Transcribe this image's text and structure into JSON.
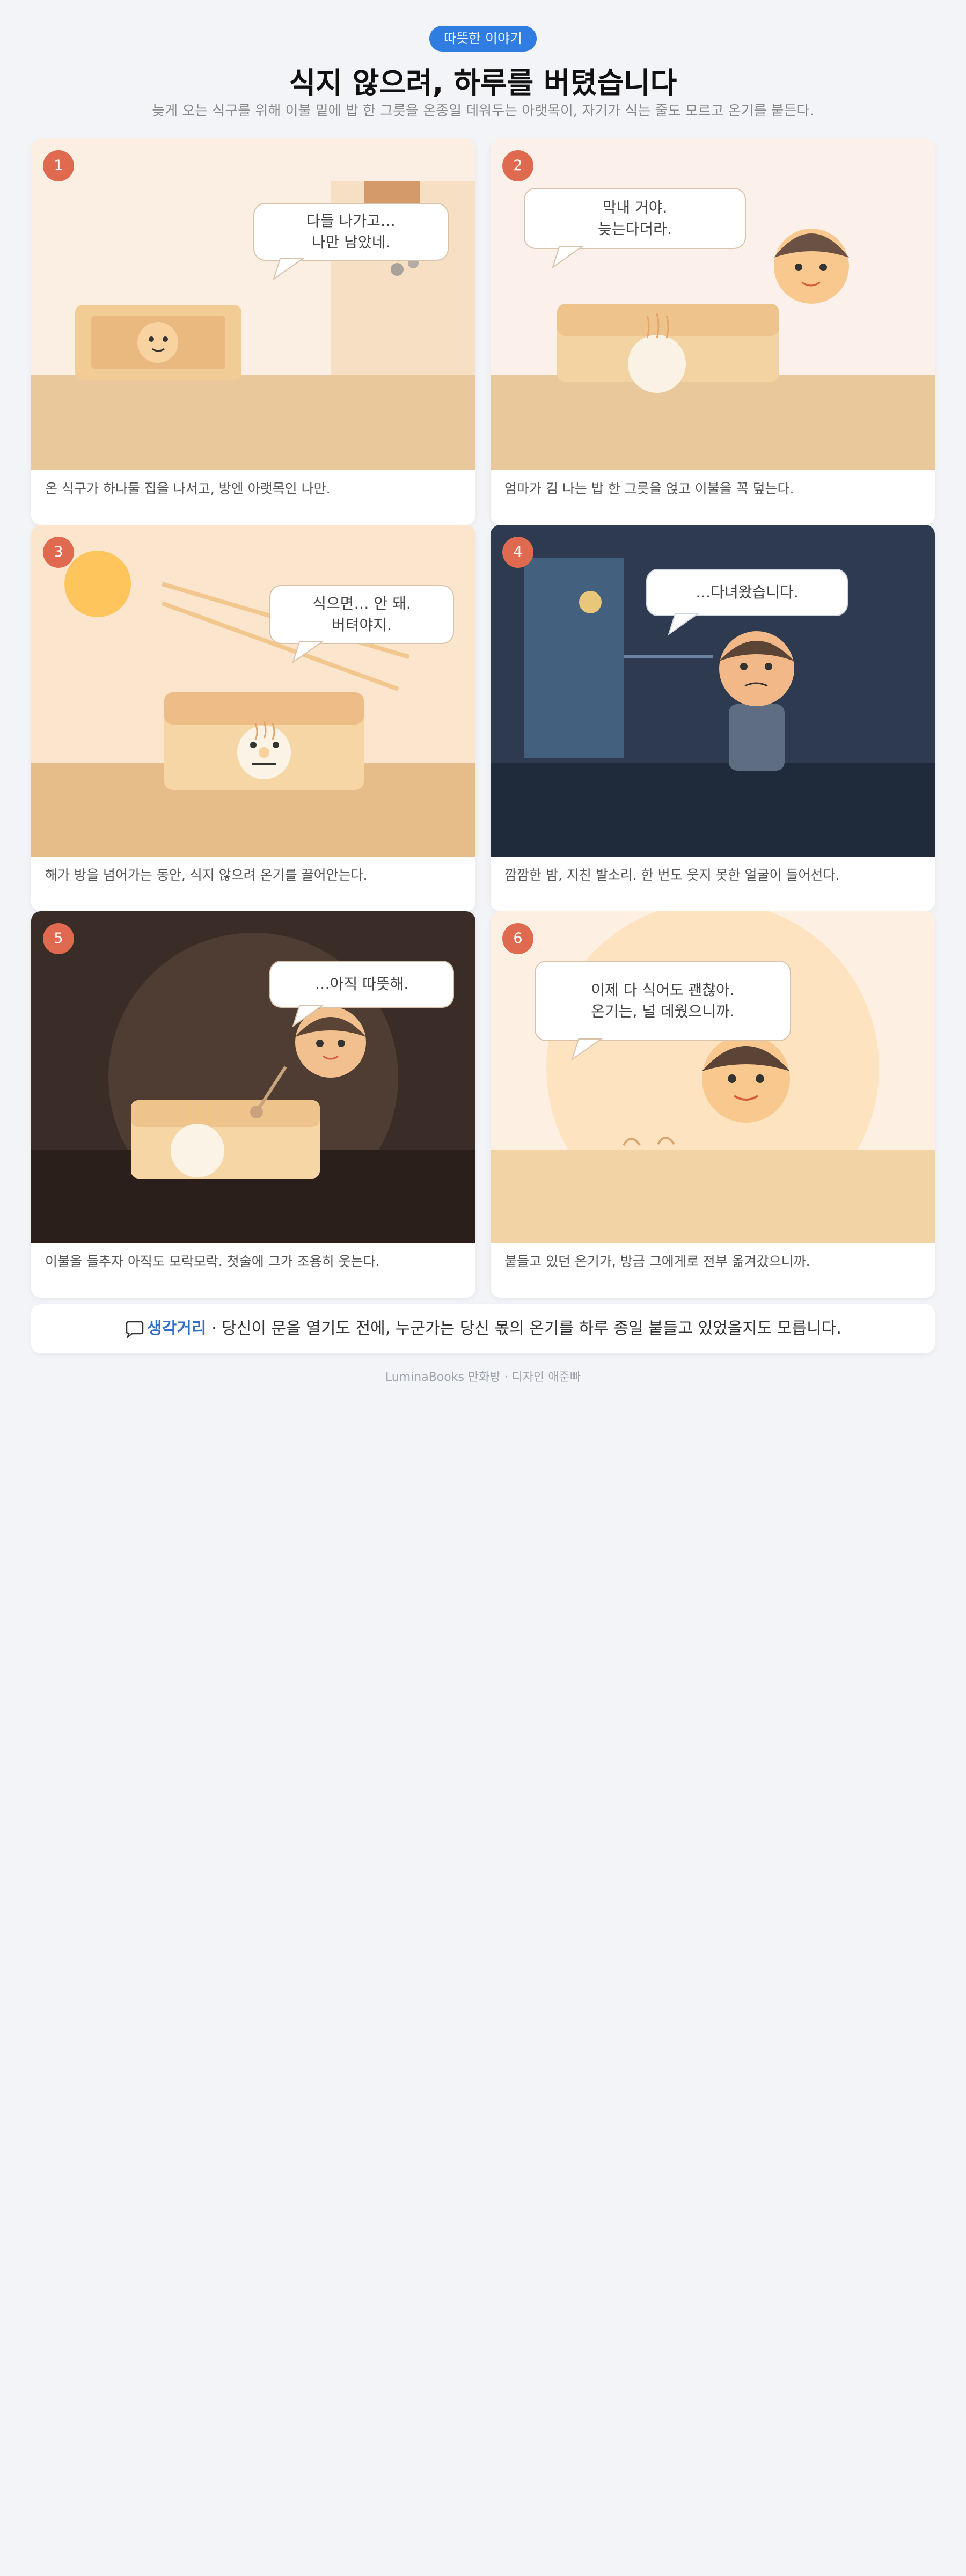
{
  "badge": "따뜻한 이야기",
  "title": "식지 않으려, 하루를 버텼습니다",
  "subtitle": "늦게 오는 식구를 위해 이불 밑에 밥 한 그릇을 온종일 데워두는 아랫목이, 자기가 식는 줄도 모르고 온기를 붙든다.",
  "panels": [
    {
      "number": "1",
      "speech": [
        "다들 나가고…",
        "나만 남았네."
      ],
      "caption": "온 식구가 하나둘 집을 나서고, 방엔 아랫목인 나만."
    },
    {
      "number": "2",
      "speech": [
        "막내 거야.",
        "늦는다더라."
      ],
      "caption": "엄마가 김 나는 밥 한 그릇을 얹고 이불을 꼭 덮는다."
    },
    {
      "number": "3",
      "speech": [
        "식으면… 안 돼.",
        "버텨야지."
      ],
      "caption": "해가 방을 넘어가는 동안, 식지 않으려 온기를 끌어안는다."
    },
    {
      "number": "4",
      "speech": [
        "…다녀왔습니다."
      ],
      "caption": "깜깜한 밤, 지친 발소리. 한 번도 웃지 못한 얼굴이 들어선다."
    },
    {
      "number": "5",
      "speech": [
        "…아직 따뜻해."
      ],
      "caption": "이불을 들추자 아직도 모락모락. 첫술에 그가 조용히 웃는다."
    },
    {
      "number": "6",
      "speech": [
        "이제 다 식어도 괜찮아.",
        "온기는, 널 데웠으니까."
      ],
      "caption": "붙들고 있던 온기가, 방금 그에게로 전부 옮겨갔으니까."
    }
  ],
  "footer": {
    "icon": "speech-bubble-icon",
    "label": "생각거리",
    "separator": "·",
    "text": "당신이 문을 열기도 전에, 누군가는 당신 몫의 온기를 하루 종일 붙들고 있었을지도 모릅니다."
  },
  "credit": "LuminaBooks 만화방 · 디자인 애준빠",
  "colors": {
    "badge": "#2f7de1",
    "number_badge": "#e06a4f",
    "warm_floor": "#e9c89c",
    "night_bg": "#2d3a4f",
    "accent_link": "#2f6fc9"
  }
}
